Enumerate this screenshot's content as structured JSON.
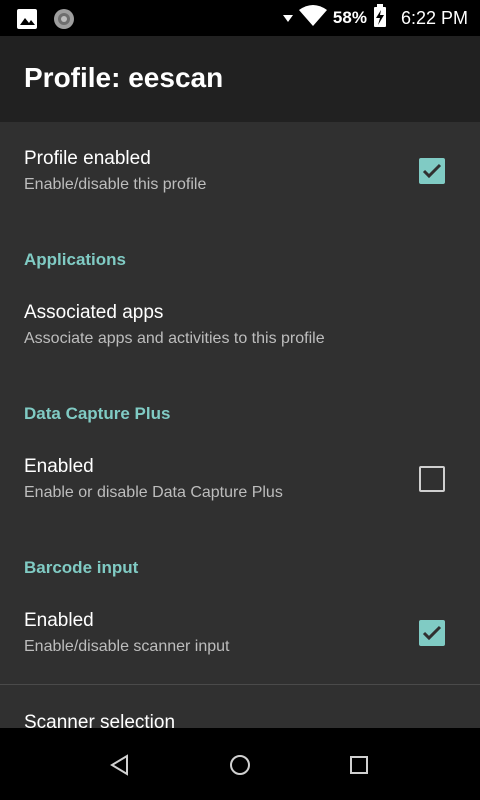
{
  "status_bar": {
    "battery_percent": "58%",
    "time": "6:22 PM",
    "icons": [
      "image-icon",
      "sync-icon",
      "wifi-icon",
      "battery-charging-icon"
    ]
  },
  "app_bar": {
    "title": "Profile: eescan"
  },
  "preferences": {
    "profile_enabled": {
      "title": "Profile enabled",
      "summary": "Enable/disable this profile",
      "checked": true
    },
    "applications_header": "Applications",
    "associated_apps": {
      "title": "Associated apps",
      "summary": "Associate apps and activities to this profile"
    },
    "data_capture_header": "Data Capture Plus",
    "dcp_enabled": {
      "title": "Enabled",
      "summary": "Enable or disable Data Capture Plus",
      "checked": false
    },
    "barcode_header": "Barcode input",
    "barcode_enabled": {
      "title": "Enabled",
      "summary": "Enable/disable scanner input",
      "checked": true
    },
    "scanner_selection": {
      "title": "Scanner selection"
    }
  },
  "colors": {
    "accent": "#80cbc4",
    "background": "#303030",
    "app_bar": "#212121"
  },
  "nav_bar": {
    "icons": [
      "back-icon",
      "home-icon",
      "recents-icon"
    ]
  }
}
